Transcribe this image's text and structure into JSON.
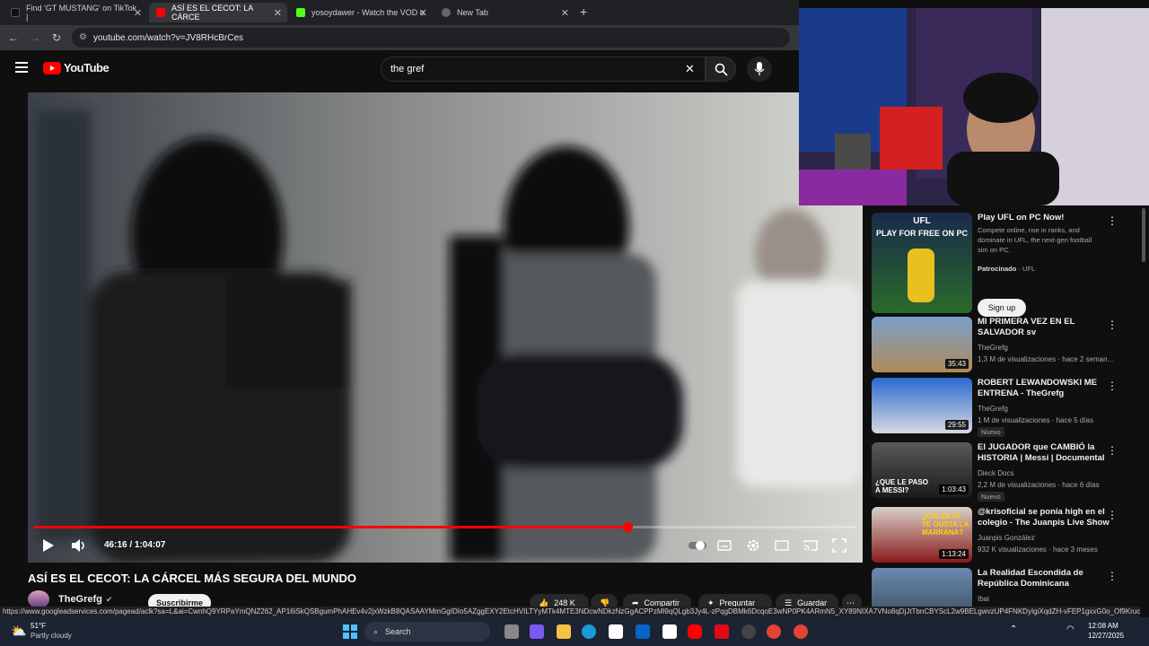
{
  "tabs": [
    {
      "label": "Find 'GT MUSTANG' on TikTok |",
      "color": "#111"
    },
    {
      "label": "ASÍ ES EL CECOT: LA CÁRCE",
      "color": "#ff0000"
    },
    {
      "label": "yosoydawer - Watch the VOD o",
      "color": "#53fc18"
    },
    {
      "label": "New Tab",
      "color": "#666"
    }
  ],
  "browser": {
    "url": "youtube.com/watch?v=JV8RHcBrCes",
    "new_tab": "+"
  },
  "youtube": {
    "logo_text": "YouTube",
    "search_value": "the gref"
  },
  "player": {
    "time": "46:16 / 1:04:07",
    "progress_fraction": 0.722
  },
  "video": {
    "title": "ASÍ ES EL CECOT: LA CÁRCEL MÁS SEGURA DEL MUNDO",
    "channel": "TheGrefg",
    "subscribe": "Suscribirme",
    "likes": "248 K",
    "share": "Compartir",
    "ask": "Preguntar",
    "save": "Guardar"
  },
  "ad": {
    "title": "Play UFL on PC Now!",
    "desc": "Compete online, rise in ranks, and dominate in UFL, the next-gen football sim on PC.",
    "sponsored": "Patrocinado",
    "advertiser": "UFL",
    "cta": "Sign up",
    "thumb_line1": "UFL",
    "thumb_line2": "PLAY FOR FREE ON PC"
  },
  "recommendations": [
    {
      "title": "MI PRIMERA VEZ EN EL SALVADOR sv",
      "channel": "TheGrefg",
      "meta": "1,3 M de visualizaciones · hace 2 seman...",
      "duration": "35:43",
      "badge": "",
      "color": "#6a8fb4"
    },
    {
      "title": "ROBERT LEWANDOWSKI ME ENTRENA - TheGrefg",
      "channel": "TheGrefg",
      "meta": "1 M de visualizaciones · hace 5 días",
      "duration": "29:55",
      "badge": "Nuevo",
      "color": "#2f6fc0"
    },
    {
      "title": "El JUGADOR que CAMBIÓ la HISTORIA | Messi | Documental",
      "channel": "Dieck Docs",
      "meta": "2,2 M de visualizaciones · hace 6 días",
      "duration": "1:03:43",
      "badge": "Nuevo",
      "color": "#3a3a3a",
      "thumb_text": "¿QUE LE PASO A MESSI?"
    },
    {
      "title": "@krisoficial se ponía high en el colegio - The Juanpis Live Show",
      "channel": "Juanpis González",
      "meta": "932 K visualizaciones · hace 3 meses",
      "duration": "1:13:24",
      "badge": "",
      "color": "#8a1c1c",
      "thumb_text": "¿CALZA 47, TE GUSTA LA MARRANA?"
    },
    {
      "title": "La Realidad Escondida de República Dominicana",
      "channel": "Ibai",
      "meta": "",
      "duration": "",
      "badge": "",
      "color": "#4a6b8a"
    }
  ],
  "status_url": "https://www.googleadservices.com/pagead/aclk?sa=L&ai=CwnhQ9YRPaYmQNZ262_AP16iSkQSBgumPhAHEv4v2jxWzkB8QASAAYMmGgIDIo5AZggEXY2EtcHVILTYyMTk4MTE3NDcwNDkzNzGgACPPzMl9qQLgb3Jy4L-zPqgDBMk6DcqoE3wNP0PK4ARmN5_XY89NIXA7VNo8qDjJtTbnCBYScL2w9BELgwvzUP4FNKDyIgiXqdZH-vFEP1gxxG0o_Of9Kruc8nP2PLIac3AH...",
  "taskbar": {
    "temp": "51°F",
    "weather": "Partly cloudy",
    "search": "Search",
    "time": "12:08 AM",
    "date": "12/27/2025"
  }
}
